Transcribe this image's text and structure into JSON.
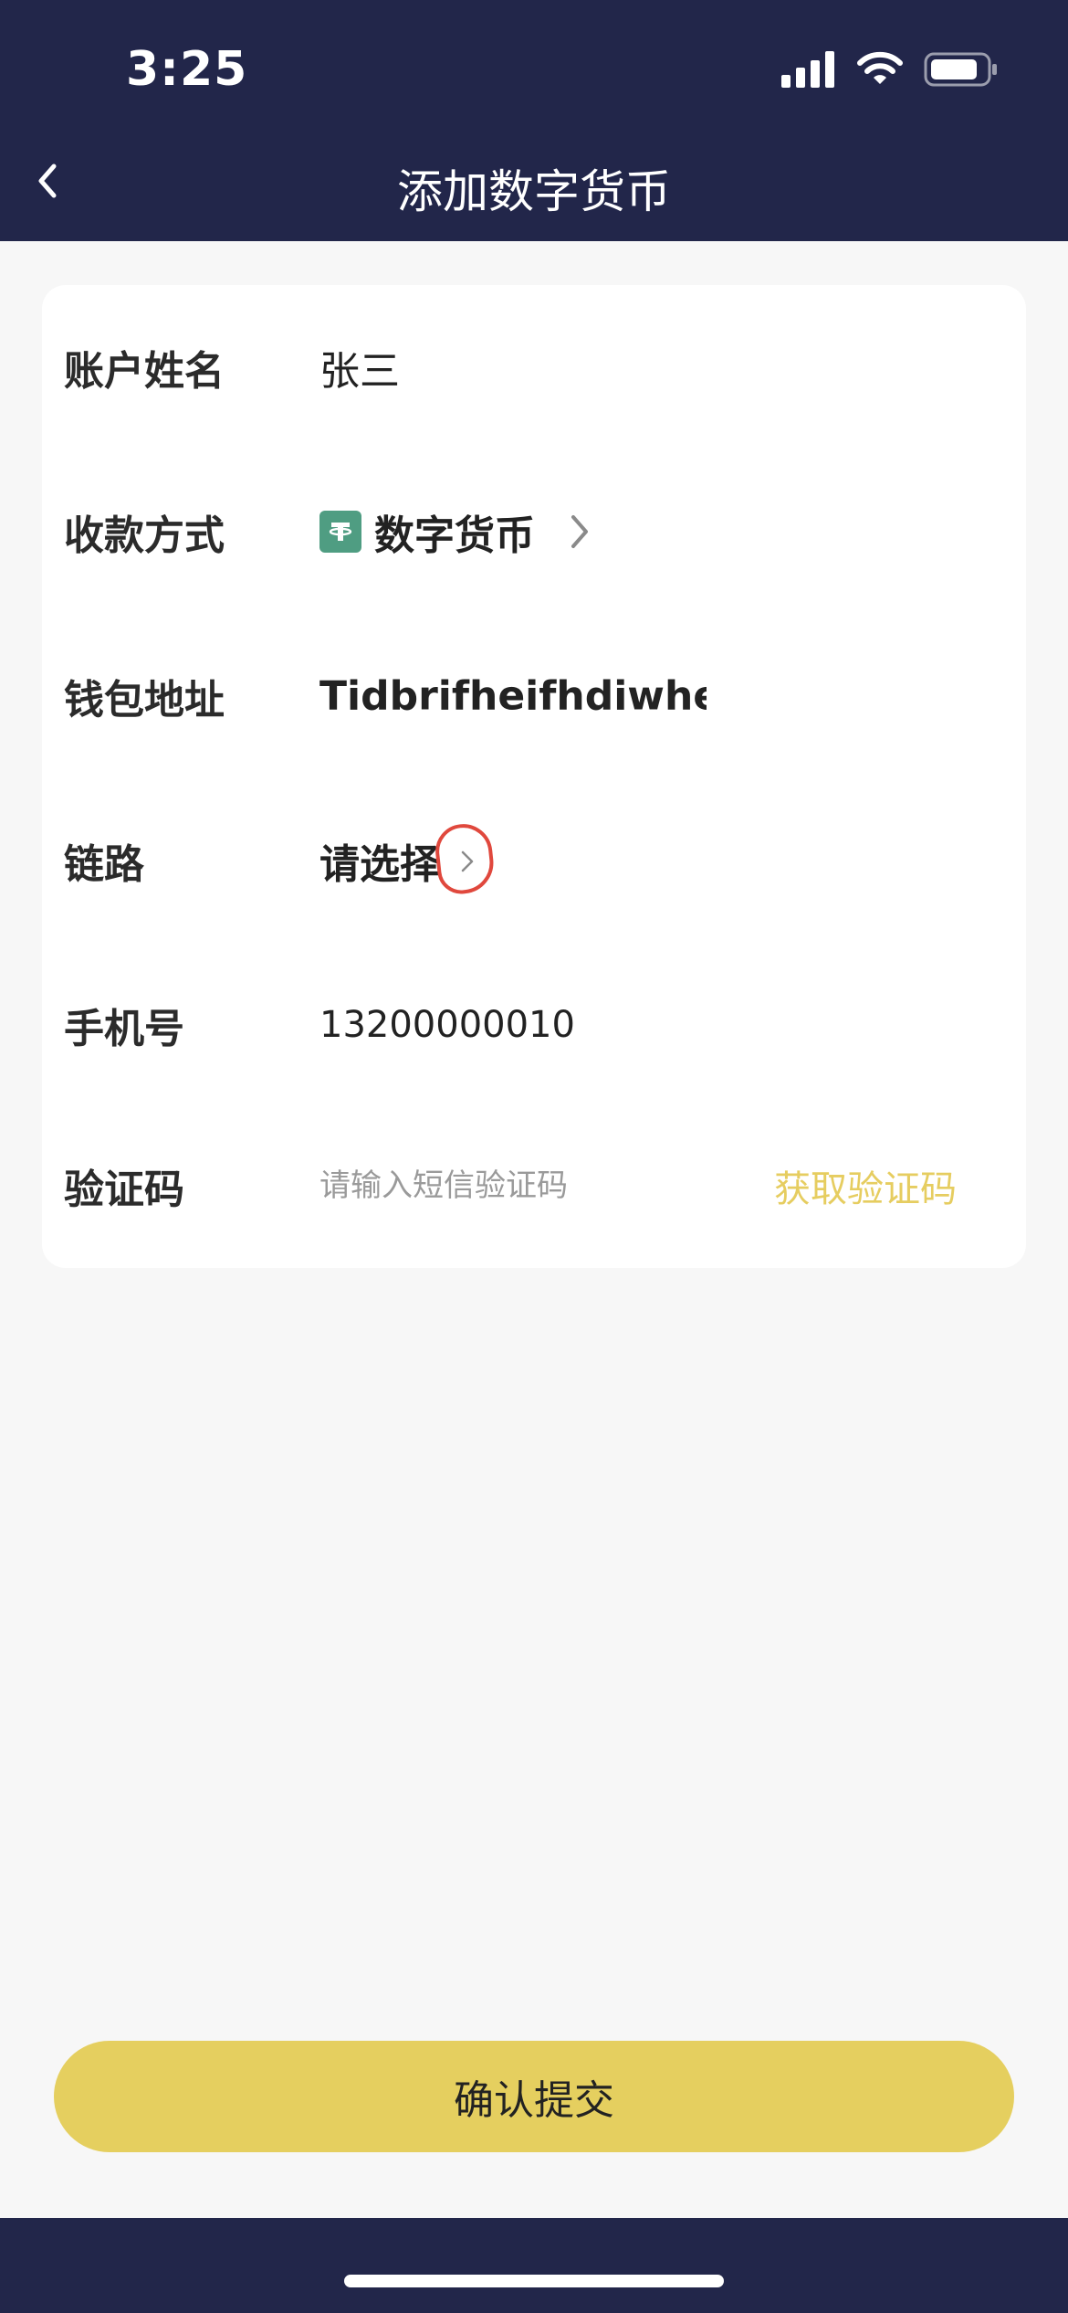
{
  "status_bar": {
    "time": "3:25"
  },
  "nav": {
    "title": "添加数字货币"
  },
  "form": {
    "account_name": {
      "label": "账户姓名",
      "value": "张三"
    },
    "payment_method": {
      "label": "收款方式",
      "value": "数字货币",
      "icon": "tether-coin-icon",
      "icon_color": "#4f9d82"
    },
    "wallet_address": {
      "label": "钱包地址",
      "value": "Tidbrifheifhdiwheifjs"
    },
    "chain": {
      "label": "链路",
      "value": "请选择"
    },
    "phone": {
      "label": "手机号",
      "value": "13200000010"
    },
    "verification": {
      "label": "验证码",
      "placeholder": "请输入短信验证码",
      "get_code_label": "获取验证码"
    }
  },
  "submit": {
    "label": "确认提交"
  },
  "colors": {
    "header_bg": "#22264a",
    "accent_yellow": "#e5cf5f",
    "get_code_text": "#e6cd60",
    "annotation_red": "#e0483d",
    "page_bg": "#f7f7f7"
  }
}
